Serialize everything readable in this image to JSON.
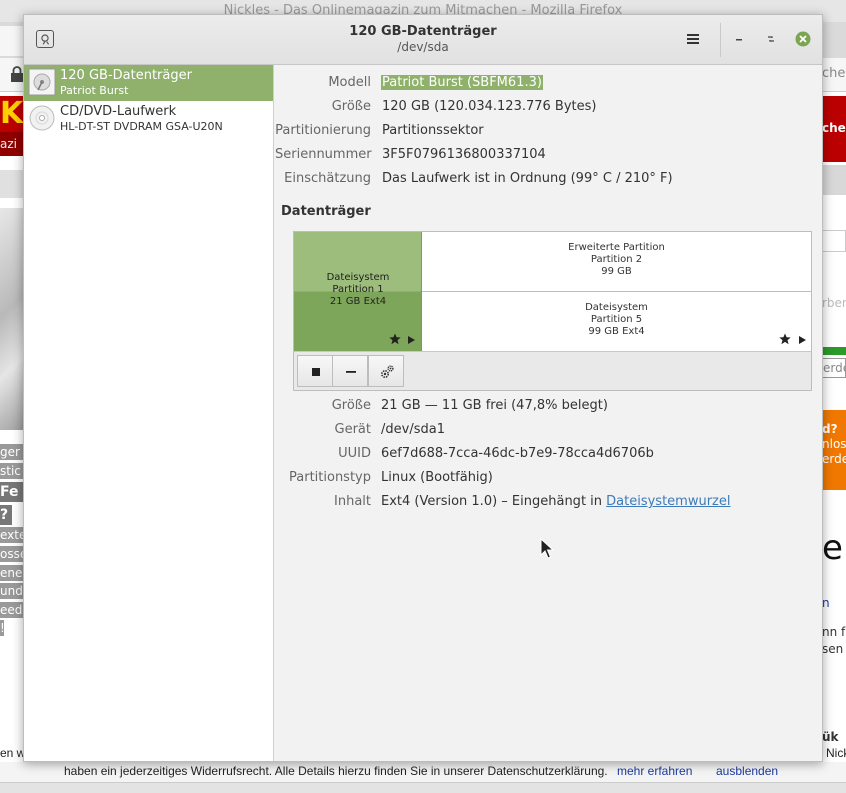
{
  "background_window": {
    "title": "Nickles - Das Onlinemagazin zum Mitmachen - Mozilla Firefox",
    "search_partial": "che",
    "logo_letter": "K",
    "logo_sub": "azi",
    "left_snippets": [
      "ger -",
      "stic",
      "Fe",
      "?",
      "exte",
      "osse",
      "ene",
      "und",
      "eede",
      "!"
    ],
    "right_snippets": [
      "chen",
      "rben",
      "erde",
      "d?",
      "nlos",
      "erde",
      "e",
      "n",
      "nn fü",
      "sen",
      "ük",
      "Nick"
    ],
    "cookie_left": "en wi",
    "cookie_text": "haben ein jederzeitiges Widerrufsrecht. Alle Details hierzu finden Sie in unserer Datenschutzerklärung.",
    "cookie_more": "mehr erfahren",
    "cookie_hide": "ausblenden",
    "colors": {
      "brand_red": "#b00000",
      "logo_yellow": "#ffd000",
      "link_blue": "#1a3aa0"
    }
  },
  "window": {
    "title": "120 GB-Datenträger",
    "subtitle": "/dev/sda"
  },
  "sidebar": {
    "devices": [
      {
        "name": "120 GB-Datenträger",
        "sub": "Patriot Burst",
        "icon": "hard-disk-icon",
        "selected": true
      },
      {
        "name": "CD/DVD-Laufwerk",
        "sub": "HL-DT-ST DVDRAM GSA-U20N",
        "icon": "optical-disc-icon",
        "selected": false
      }
    ]
  },
  "disk": {
    "model_label": "Modell",
    "model": "Patriot Burst (SBFM61.3)",
    "size_label": "Größe",
    "size": "120 GB (120.034.123.776 Bytes)",
    "partitioning_label": "Partitionierung",
    "partitioning": "Partitionssektor",
    "serial_label": "Seriennummer",
    "serial": "3F5F0796136800337104",
    "assessment_label": "Einschätzung",
    "assessment": "Das Laufwerk ist in Ordnung (99° C / 210° F)"
  },
  "volumes": {
    "section_title": "Datenträger",
    "partitions": [
      {
        "line1": "Dateisystem",
        "line2": "Partition 1",
        "line3": "21 GB Ext4",
        "selected": true
      },
      {
        "line1": "Erweiterte Partition",
        "line2": "Partition 2",
        "line3": "99 GB",
        "selected": false
      },
      {
        "line1": "Dateisystem",
        "line2": "Partition 5",
        "line3": "99 GB Ext4",
        "selected": false
      }
    ],
    "toolbar": [
      {
        "icon": "stop-icon",
        "name": "unmount-button"
      },
      {
        "icon": "minus-icon",
        "name": "delete-partition-button"
      },
      {
        "icon": "gears-icon",
        "name": "partition-options-button"
      }
    ]
  },
  "partition": {
    "size_label": "Größe",
    "size": "21 GB — 11 GB frei (47,8% belegt)",
    "device_label": "Gerät",
    "device": "/dev/sda1",
    "uuid_label": "UUID",
    "uuid": "6ef7d688-7cca-46dc-b7e9-78cca4d6706b",
    "type_label": "Partitionstyp",
    "type": "Linux (Bootfähig)",
    "contents_label": "Inhalt",
    "contents_prefix": "Ext4 (Version 1.0) – Eingehängt in ",
    "contents_link": "Dateisystemwurzel"
  },
  "colors": {
    "selection_green": "#8fb16b",
    "partition_fill": "#9cbd7b",
    "close_button": "#7ca552",
    "link": "#3d7ab8"
  }
}
